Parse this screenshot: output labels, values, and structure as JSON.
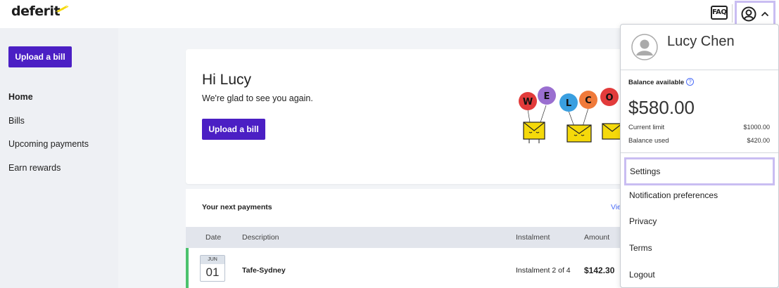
{
  "header": {
    "logo_text": "deferit",
    "faq_label": "FAQ",
    "profile_icon": "user-circle-icon",
    "caret_icon": "chevron-up-icon"
  },
  "sidebar": {
    "upload_label": "Upload a bill",
    "items": [
      {
        "label": "Home"
      },
      {
        "label": "Bills"
      },
      {
        "label": "Upcoming payments"
      },
      {
        "label": "Earn rewards"
      }
    ]
  },
  "welcome": {
    "greeting": "Hi Lucy",
    "subtitle": "We're glad to see you again.",
    "upload_label": "Upload a bill",
    "balloon_letters": [
      "W",
      "E",
      "L",
      "C",
      "O"
    ]
  },
  "payments": {
    "title": "Your next payments",
    "view_link": "Vie",
    "columns": {
      "date": "Date",
      "description": "Description",
      "instalment": "Instalment",
      "amount": "Amount"
    },
    "rows": [
      {
        "month": "JUN",
        "day": "01",
        "description": "Tafe-Sydney",
        "instalment": "Instalment 2 of 4",
        "amount": "$142.30"
      }
    ]
  },
  "dropdown": {
    "name": "Lucy Chen",
    "balance_label": "Balance available",
    "balance_help": "?",
    "balance_amount": "$580.00",
    "current_limit_label": "Current limit",
    "current_limit_value": "$1000.00",
    "balance_used_label": "Balance used",
    "balance_used_value": "$420.00",
    "menu": [
      {
        "label": "Settings"
      },
      {
        "label": "Notification preferences"
      },
      {
        "label": "Privacy"
      },
      {
        "label": "Terms"
      },
      {
        "label": "Logout"
      }
    ]
  },
  "colors": {
    "brand_purple": "#4b1fc4",
    "accent_yellow": "#f5d90a",
    "highlight_lavender": "#c9bdf2",
    "row_accent_green": "#4cc26e",
    "link_blue": "#4a6cf7"
  }
}
